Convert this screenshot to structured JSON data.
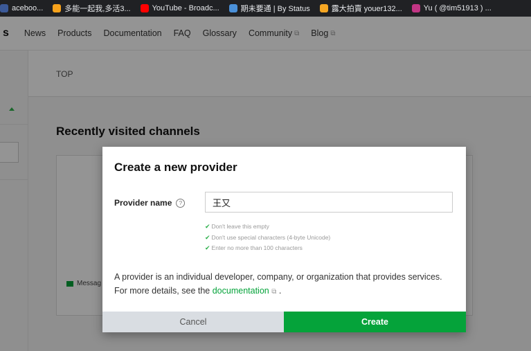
{
  "bookmarks": [
    {
      "label": "aceboo...",
      "color": "#3b5998"
    },
    {
      "label": "多能一起我,多活3...",
      "color": "#f7a21b"
    },
    {
      "label": "YouTube - Broadc...",
      "color": "#ff0000"
    },
    {
      "label": "期未要通 | By Status",
      "color": "#4a90d9"
    },
    {
      "label": "露大拍賣 youer132...",
      "color": "#f5a623"
    },
    {
      "label": "Yu ( @tim51913 ) ...",
      "color": "#c13584"
    }
  ],
  "nav": {
    "logo_fragment": "s",
    "items": [
      "News",
      "Products",
      "Documentation",
      "FAQ",
      "Glossary",
      "Community",
      "Blog"
    ],
    "ext_mark": "⧉"
  },
  "breadcrumb": "TOP",
  "recent_title": "Recently visited channels",
  "legend_label": "Messag",
  "modal": {
    "title": "Create a new provider",
    "label": "Provider name",
    "help_mark": "?",
    "input_value": "王又",
    "rules": [
      "Don't leave this empty",
      "Don't use special characters (4-byte Unicode)",
      "Enter no more than 100 characters"
    ],
    "desc_before": "A provider is an individual developer, company, or organization that provides services. For more details, see the ",
    "doc_link": "documentation",
    "desc_after": " .",
    "cancel": "Cancel",
    "create": "Create"
  },
  "colors": {
    "accent": "#05a33a",
    "check": "#2fb14d"
  }
}
